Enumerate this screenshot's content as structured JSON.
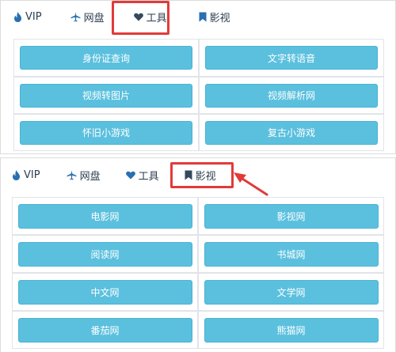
{
  "top": {
    "tabs": [
      {
        "label": "VIP",
        "icon": "fire-icon"
      },
      {
        "label": "网盘",
        "icon": "plane-icon"
      },
      {
        "label": "工具",
        "icon": "heart-icon"
      },
      {
        "label": "影视",
        "icon": "bookmark-icon"
      }
    ],
    "active_tab": "工具",
    "buttons": [
      "身份证查询",
      "文字转语音",
      "视频转图片",
      "视频解析网",
      "怀旧小游戏",
      "复古小游戏"
    ]
  },
  "bottom": {
    "tabs": [
      {
        "label": "VIP",
        "icon": "fire-icon"
      },
      {
        "label": "网盘",
        "icon": "plane-icon"
      },
      {
        "label": "工具",
        "icon": "heart-icon"
      },
      {
        "label": "影视",
        "icon": "bookmark-icon"
      }
    ],
    "active_tab": "影视",
    "buttons": [
      "电影网",
      "影视网",
      "阅读网",
      "书城网",
      "中文网",
      "文学网",
      "番茄网",
      "熊猫网"
    ]
  },
  "colors": {
    "button_bg": "#5bc0de",
    "highlight": "#e23a3a",
    "icon_blue": "#2a6fb0",
    "icon_dark": "#34495e"
  }
}
